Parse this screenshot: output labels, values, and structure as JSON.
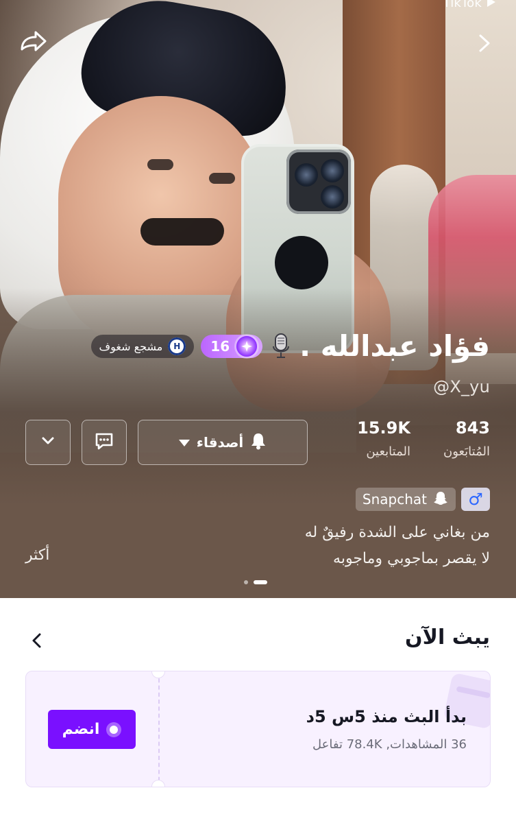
{
  "top_bar": {
    "brand": "TikTok"
  },
  "profile": {
    "name": "فؤاد عبدالله .",
    "handle": "@X_yu",
    "level": "16",
    "club_label": "مشجع شغوف",
    "club_logo_text": "H"
  },
  "stats": {
    "following": {
      "value": "843",
      "label": "المُتابَعون"
    },
    "followers": {
      "value": "15.9K",
      "label": "المتابعين"
    }
  },
  "actions": {
    "friends_label": "أصدقاء"
  },
  "tags": {
    "snapchat": "Snapchat",
    "gender_symbol": "♂"
  },
  "bio": {
    "line1": "من بغاني على الشدة رفيقٌ له",
    "line2": "لا يقصر بماجوبي وماجوبه",
    "more_label": "أكثر"
  },
  "live": {
    "title": "يبث الآن",
    "started": "بدأ البث منذ 5س 5د",
    "meta": "36 المشاهدات, 78.4K تفاعل",
    "join_label": "انضم"
  },
  "icons": {
    "share": "share-icon",
    "next": "chevron-right-icon",
    "mic": "microphone-icon",
    "bell": "bell-icon",
    "message": "message-icon",
    "dropdown": "chevron-down-icon",
    "back": "chevron-left-icon",
    "snapchat": "snapchat-ghost-icon",
    "male": "male-icon",
    "live": "live-dot-icon"
  },
  "colors": {
    "overlay_brown": "#6b574a",
    "primary_purple": "#7a10ff",
    "card_bg": "#f8f1ff"
  }
}
